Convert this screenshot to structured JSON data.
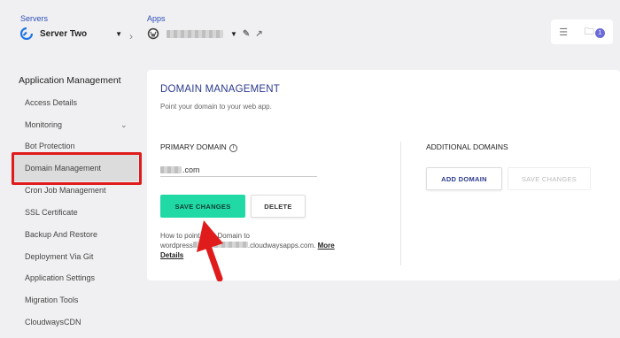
{
  "header": {
    "servers_label": "Servers",
    "server_name": "Server Two",
    "apps_label": "Apps",
    "notification_count": "1"
  },
  "sidebar": {
    "heading": "Application Management",
    "items": [
      {
        "label": "Access Details"
      },
      {
        "label": "Monitoring"
      },
      {
        "label": "Bot Protection"
      },
      {
        "label": "Domain Management"
      },
      {
        "label": "Cron Job Management"
      },
      {
        "label": "SSL Certificate"
      },
      {
        "label": "Backup And Restore"
      },
      {
        "label": "Deployment Via Git"
      },
      {
        "label": "Application Settings"
      },
      {
        "label": "Migration Tools"
      },
      {
        "label": "CloudwaysCDN"
      }
    ]
  },
  "main": {
    "title": "DOMAIN MANAGEMENT",
    "subtitle": "Point your domain to your web app.",
    "primary_domain_label": "PRIMARY DOMAIN",
    "primary_domain_suffix": ".com",
    "save_button": "SAVE CHANGES",
    "delete_button": "DELETE",
    "help_prefix": "How to point your Domain to",
    "help_domain_prefix": "wordpress",
    "help_domain_suffix": ".cloudwaysapps.com.",
    "more_link": "More",
    "details_link": "Details",
    "additional_domains_label": "ADDITIONAL DOMAINS",
    "add_domain_button": "ADD DOMAIN",
    "save_changes_disabled": "SAVE CHANGES"
  },
  "colors": {
    "accent_green": "#20d9a4",
    "title_blue": "#2c3a8c",
    "highlight_red": "#e01b1b"
  }
}
